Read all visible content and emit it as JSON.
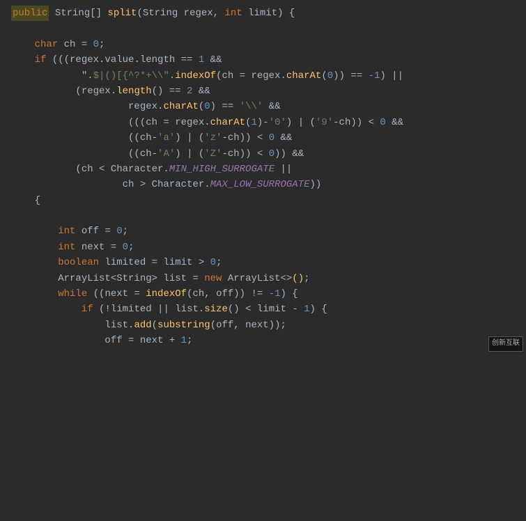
{
  "code": {
    "lines": [
      {
        "id": 1,
        "tokens": [
          {
            "text": "public",
            "class": "highlight-public"
          },
          {
            "text": " String[] ",
            "class": "plain"
          },
          {
            "text": "split",
            "class": "method"
          },
          {
            "text": "(String regex, ",
            "class": "plain"
          },
          {
            "text": "int",
            "class": "kw"
          },
          {
            "text": " limit) {",
            "class": "plain"
          }
        ]
      },
      {
        "id": 2,
        "tokens": []
      },
      {
        "id": 3,
        "tokens": [
          {
            "text": "    ",
            "class": "plain"
          },
          {
            "text": "char",
            "class": "kw"
          },
          {
            "text": " ch = ",
            "class": "plain"
          },
          {
            "text": "0",
            "class": "num"
          },
          {
            "text": ";",
            "class": "plain"
          }
        ]
      },
      {
        "id": 4,
        "tokens": [
          {
            "text": "    ",
            "class": "plain"
          },
          {
            "text": "if",
            "class": "kw"
          },
          {
            "text": " (((regex.value.length == ",
            "class": "plain"
          },
          {
            "text": "1",
            "class": "num"
          },
          {
            "text": " &&",
            "class": "plain"
          }
        ]
      },
      {
        "id": 5,
        "tokens": [
          {
            "text": "            \".",
            "class": "plain"
          },
          {
            "text": "$|()[{^?*+\\\\\"",
            "class": "str"
          },
          {
            "text": ".",
            "class": "plain"
          },
          {
            "text": "indexOf",
            "class": "method"
          },
          {
            "text": "(ch = regex.",
            "class": "plain"
          },
          {
            "text": "charAt",
            "class": "method"
          },
          {
            "text": "(",
            "class": "plain"
          },
          {
            "text": "0",
            "class": "num"
          },
          {
            "text": ")) == ",
            "class": "plain"
          },
          {
            "text": "-1",
            "class": "num"
          },
          {
            "text": ") ||",
            "class": "plain"
          }
        ]
      },
      {
        "id": 6,
        "tokens": [
          {
            "text": "           (regex.",
            "class": "plain"
          },
          {
            "text": "length",
            "class": "method"
          },
          {
            "text": "() == ",
            "class": "plain"
          },
          {
            "text": "2",
            "class": "num"
          },
          {
            "text": " &&",
            "class": "plain"
          }
        ]
      },
      {
        "id": 7,
        "tokens": [
          {
            "text": "                    regex.",
            "class": "plain"
          },
          {
            "text": "charAt",
            "class": "method"
          },
          {
            "text": "(",
            "class": "plain"
          },
          {
            "text": "0",
            "class": "num"
          },
          {
            "text": ") == ",
            "class": "plain"
          },
          {
            "text": "'\\\\'",
            "class": "str"
          },
          {
            "text": " &&",
            "class": "plain"
          }
        ]
      },
      {
        "id": 8,
        "tokens": [
          {
            "text": "                    (((ch = regex.",
            "class": "plain"
          },
          {
            "text": "charAt",
            "class": "method"
          },
          {
            "text": "(",
            "class": "plain"
          },
          {
            "text": "1",
            "class": "num"
          },
          {
            "text": ")-",
            "class": "plain"
          },
          {
            "text": "'0'",
            "class": "str"
          },
          {
            "text": ") | (",
            "class": "plain"
          },
          {
            "text": "'9'",
            "class": "str"
          },
          {
            "text": "-ch)) < ",
            "class": "plain"
          },
          {
            "text": "0",
            "class": "num"
          },
          {
            "text": " &&",
            "class": "plain"
          }
        ]
      },
      {
        "id": 9,
        "tokens": [
          {
            "text": "                    ((ch-",
            "class": "plain"
          },
          {
            "text": "'a'",
            "class": "str"
          },
          {
            "text": ") | (",
            "class": "plain"
          },
          {
            "text": "'z'",
            "class": "str"
          },
          {
            "text": "-ch)) < ",
            "class": "plain"
          },
          {
            "text": "0",
            "class": "num"
          },
          {
            "text": " &&",
            "class": "plain"
          }
        ]
      },
      {
        "id": 10,
        "tokens": [
          {
            "text": "                    ((ch-",
            "class": "plain"
          },
          {
            "text": "'A'",
            "class": "str"
          },
          {
            "text": ") | (",
            "class": "plain"
          },
          {
            "text": "'Z'",
            "class": "str"
          },
          {
            "text": "-ch)) < ",
            "class": "plain"
          },
          {
            "text": "0",
            "class": "num"
          },
          {
            "text": ")) &&",
            "class": "plain"
          }
        ]
      },
      {
        "id": 11,
        "tokens": [
          {
            "text": "           (ch < Character.",
            "class": "plain"
          },
          {
            "text": "MIN_HIGH_SURROGATE",
            "class": "field-italic"
          },
          {
            "text": " ||",
            "class": "plain"
          }
        ]
      },
      {
        "id": 12,
        "tokens": [
          {
            "text": "                   ch > Character.",
            "class": "plain"
          },
          {
            "text": "MAX_LOW_SURROGATE",
            "class": "field-italic"
          },
          {
            "text": "))",
            "class": "plain"
          }
        ]
      },
      {
        "id": 13,
        "tokens": [
          {
            "text": "    {",
            "class": "plain"
          }
        ]
      },
      {
        "id": 14,
        "tokens": []
      },
      {
        "id": 15,
        "tokens": [
          {
            "text": "        ",
            "class": "plain"
          },
          {
            "text": "int",
            "class": "kw"
          },
          {
            "text": " off = ",
            "class": "plain"
          },
          {
            "text": "0",
            "class": "num"
          },
          {
            "text": ";",
            "class": "plain"
          }
        ]
      },
      {
        "id": 16,
        "tokens": [
          {
            "text": "        ",
            "class": "plain"
          },
          {
            "text": "int",
            "class": "kw"
          },
          {
            "text": " next = ",
            "class": "plain"
          },
          {
            "text": "0",
            "class": "num"
          },
          {
            "text": ";",
            "class": "plain"
          }
        ]
      },
      {
        "id": 17,
        "tokens": [
          {
            "text": "        ",
            "class": "plain"
          },
          {
            "text": "boolean",
            "class": "kw"
          },
          {
            "text": " limited = limit > ",
            "class": "plain"
          },
          {
            "text": "0",
            "class": "num"
          },
          {
            "text": ";",
            "class": "plain"
          }
        ]
      },
      {
        "id": 18,
        "tokens": [
          {
            "text": "        ArrayList<String> list = ",
            "class": "plain"
          },
          {
            "text": "new",
            "class": "kw"
          },
          {
            "text": " ArrayList<>",
            "class": "plain"
          },
          {
            "text": "()",
            "class": "method"
          },
          {
            "text": ";",
            "class": "plain"
          }
        ]
      },
      {
        "id": 19,
        "tokens": [
          {
            "text": "        ",
            "class": "plain"
          },
          {
            "text": "while",
            "class": "kw"
          },
          {
            "text": " ((next = ",
            "class": "plain"
          },
          {
            "text": "indexOf",
            "class": "method"
          },
          {
            "text": "(ch, off)) != ",
            "class": "plain"
          },
          {
            "text": "-1",
            "class": "num"
          },
          {
            "text": ") {",
            "class": "plain"
          }
        ]
      },
      {
        "id": 20,
        "tokens": [
          {
            "text": "            ",
            "class": "plain"
          },
          {
            "text": "if",
            "class": "kw"
          },
          {
            "text": " (!limited || list.",
            "class": "plain"
          },
          {
            "text": "size",
            "class": "method"
          },
          {
            "text": "() < limit - ",
            "class": "plain"
          },
          {
            "text": "1",
            "class": "num"
          },
          {
            "text": ") {",
            "class": "plain"
          }
        ]
      },
      {
        "id": 21,
        "tokens": [
          {
            "text": "                list.",
            "class": "plain"
          },
          {
            "text": "add",
            "class": "method"
          },
          {
            "text": "(",
            "class": "plain"
          },
          {
            "text": "substring",
            "class": "method"
          },
          {
            "text": "(off, next));",
            "class": "plain"
          }
        ]
      },
      {
        "id": 22,
        "tokens": [
          {
            "text": "                off = next + ",
            "class": "plain"
          },
          {
            "text": "1",
            "class": "num"
          },
          {
            "text": ";",
            "class": "plain"
          }
        ]
      }
    ]
  },
  "watermark": "创新互联"
}
